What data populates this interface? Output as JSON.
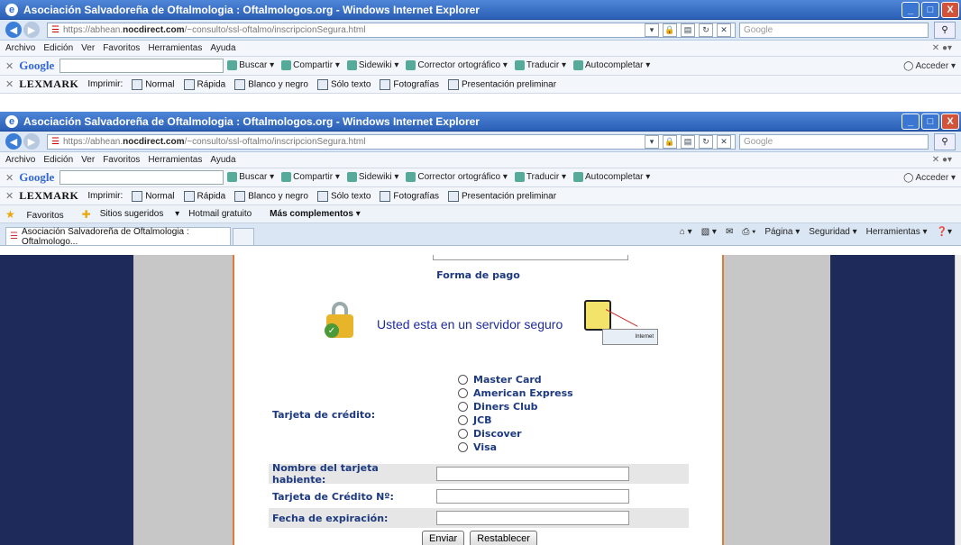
{
  "window": {
    "title": "Asociación Salvadoreña de Oftalmologia : Oftalmologos.org - Windows Internet Explorer",
    "min": "_",
    "max": "□",
    "close": "X"
  },
  "address": {
    "url_prefix": "https://abhean.",
    "url_host": "nocdirect.com",
    "url_path": "/~consulto/ssl-oftalmo/inscripcionSegura.html",
    "search_placeholder": "Google"
  },
  "menu": [
    "Archivo",
    "Edición",
    "Ver",
    "Favoritos",
    "Herramientas",
    "Ayuda"
  ],
  "googlebar": {
    "logo": "Google",
    "items": [
      "Buscar",
      "Compartir",
      "Sidewiki",
      "Corrector ortográfico",
      "Traducir",
      "Autocompletar"
    ],
    "right": "Acceder"
  },
  "lexmark": {
    "logo": "LEXMARK",
    "print_label": "Imprimir:",
    "items": [
      "Normal",
      "Rápida",
      "Blanco y negro",
      "Sólo texto",
      "Fotografías",
      "Presentación preliminar"
    ]
  },
  "favorites": {
    "label": "Favoritos",
    "items": [
      "Sitios sugeridos",
      "Hotmail gratuito",
      "Más complementos"
    ]
  },
  "tab": {
    "title": "Asociación Salvadoreña de Oftalmologia : Oftalmologo...",
    "commands": [
      "Página",
      "Seguridad",
      "Herramientas"
    ]
  },
  "page": {
    "form_title": "Forma de pago",
    "secure_text": "Usted esta en un servidor seguro",
    "ie_strip_text": "Internet",
    "credit_label": "Tarjeta de crédito:",
    "card_options": [
      "Master Card",
      "American Express",
      "Diners Club",
      "JCB",
      "Discover",
      "Visa"
    ],
    "fields": [
      {
        "label": "Nombre del tarjeta habiente:",
        "value": ""
      },
      {
        "label": "Tarjeta de Crédito Nº:",
        "value": ""
      },
      {
        "label": "Fecha de expiración:",
        "value": ""
      }
    ],
    "submit": "Enviar",
    "reset": "Restablecer"
  }
}
